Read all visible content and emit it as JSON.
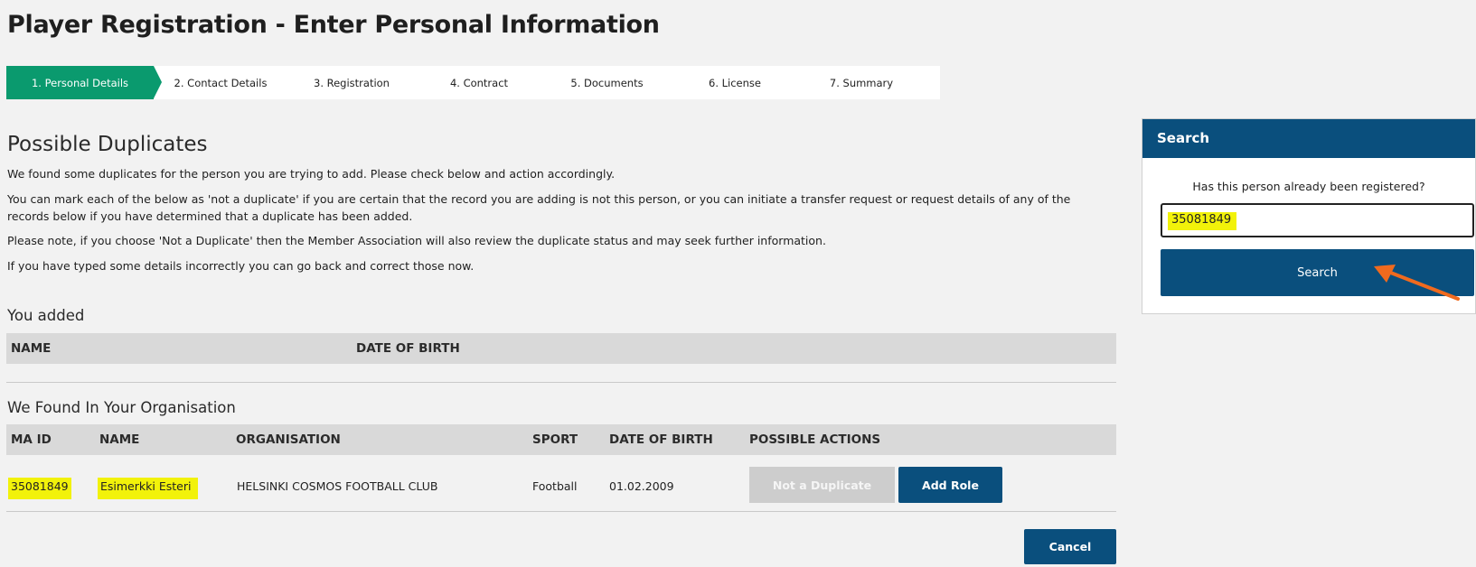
{
  "page": {
    "title": "Player Registration - Enter Personal Information"
  },
  "stepper": {
    "steps": [
      {
        "label": "1. Personal Details"
      },
      {
        "label": "2. Contact Details"
      },
      {
        "label": "3. Registration"
      },
      {
        "label": "4. Contract"
      },
      {
        "label": "5. Documents"
      },
      {
        "label": "6. License"
      },
      {
        "label": "7. Summary"
      }
    ],
    "active_step": 1
  },
  "duplicates": {
    "title": "Possible Duplicates",
    "para1": "We found some duplicates for the person you are trying to add. Please check below and action accordingly.",
    "para2": "You can mark each of the below as 'not a duplicate' if you are certain that the record you are adding is not this person, or you can initiate a transfer request or request details of any of the records below if you have determined that a duplicate has been added.",
    "para3": "Please note, if you choose 'Not a Duplicate' then the Member Association will also review the duplicate status and may seek further information.",
    "para4": "If you have typed some details incorrectly you can go back and correct those now."
  },
  "you_added": {
    "title": "You added",
    "headers": {
      "name": "NAME",
      "dob": "DATE OF BIRTH"
    }
  },
  "found": {
    "title": "We Found In Your Organisation",
    "headers": {
      "ma_id": "MA ID",
      "name": "NAME",
      "organisation": "ORGANISATION",
      "sport": "SPORT",
      "dob": "DATE OF BIRTH",
      "actions": "POSSIBLE ACTIONS"
    },
    "rows": [
      {
        "ma_id": "35081849",
        "name": "Esimerkki Esteri",
        "organisation": "HELSINKI COSMOS FOOTBALL CLUB",
        "sport": "Football",
        "dob": "01.02.2009",
        "not_duplicate_label": "Not a Duplicate",
        "add_role_label": "Add Role"
      }
    ]
  },
  "cancel_label": "Cancel",
  "search": {
    "header": "Search",
    "question": "Has this person already been registered?",
    "input_value": "35081849",
    "button_label": "Search"
  },
  "colors": {
    "accent_green": "#0a9a6e",
    "primary_blue": "#0a4f7d",
    "highlight_yellow": "#f2f20a",
    "arrow_orange": "#f06a1e"
  }
}
